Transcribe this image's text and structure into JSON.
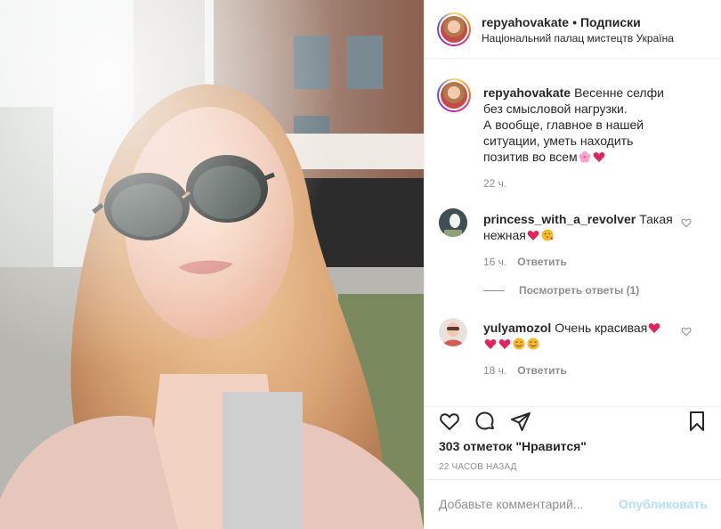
{
  "post": {
    "author": "repyahovakate",
    "separator": "•",
    "follow_status": "Подписки",
    "location": "Національний палац мистецтв Україна"
  },
  "caption": {
    "username": "repyahovakate",
    "text": "Весенне селфи без смысловой нагрузки.\nА вообще, главное в нашей ситуации, уметь находить позитив во всем",
    "emojis": [
      "cherry-blossom",
      "red-heart"
    ],
    "time": "22 ч."
  },
  "comments": [
    {
      "username": "princess_with_a_revolver",
      "text": "Такая нежная",
      "emojis": [
        "red-heart",
        "face-blowing-kiss"
      ],
      "time": "16 ч.",
      "reply_label": "Ответить",
      "view_replies": "Посмотреть ответы (1)"
    },
    {
      "username": "yulyamozol",
      "text": "Очень красивая",
      "emojis": [
        "red-heart",
        "red-heart",
        "red-heart",
        "smiling-face",
        "smiling-face"
      ],
      "time": "18 ч.",
      "reply_label": "Ответить"
    }
  ],
  "actions": {
    "like_icon": "heart-outline-icon",
    "comment_icon": "comment-icon",
    "share_icon": "paper-plane-icon",
    "save_icon": "bookmark-icon"
  },
  "likes": "303 отметок \"Нравится\"",
  "timestamp": "22 ЧАСОВ НАЗАД",
  "add_comment": {
    "placeholder": "Добавьте комментарий...",
    "post_label": "Опубликовать"
  },
  "colors": {
    "accent_disabled": "#b2dffc",
    "heart_emoji": "#e0245e",
    "muted": "#8e8e8e"
  }
}
